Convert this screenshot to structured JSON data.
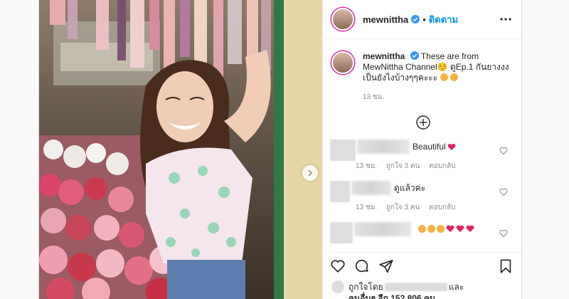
{
  "post": {
    "username": "mewnittha",
    "header_separator": "•",
    "follow_label": "ติดตาม",
    "caption_text": "These are from MewNittha Channel☺️ ดูEp.1 กันยางงง เป็นยังไงบ้างๆๆคะะะ",
    "caption_time": "13 ชม."
  },
  "comments": [
    {
      "text": "Beautiful",
      "time": "13 ชม.",
      "likes": "ถูกใจ 3 คน",
      "reply": "ตอบกลับ"
    },
    {
      "text": "ดูแล้วค่ะ",
      "time": "13 ชม.",
      "likes": "ถูกใจ 3 คน",
      "reply": "ตอบกลับ"
    },
    {
      "text": ""
    }
  ],
  "likes_line": {
    "prefix": "ถูกใจโดย",
    "and": "และ",
    "others_prefix": "คนอื่นๆ อีก",
    "count": "152,806",
    "suffix": "คน"
  },
  "icons": {
    "verified": "verified-badge-icon",
    "more": "more-options-icon",
    "load_more": "plus-circle-icon",
    "like": "heart-icon",
    "comment": "comment-icon",
    "share": "share-icon",
    "save": "bookmark-icon",
    "next": "chevron-right-icon"
  },
  "colors": {
    "accent": "#0095f6",
    "heart": "#ed4956",
    "text": "#262626",
    "muted": "#8e8e8e"
  }
}
